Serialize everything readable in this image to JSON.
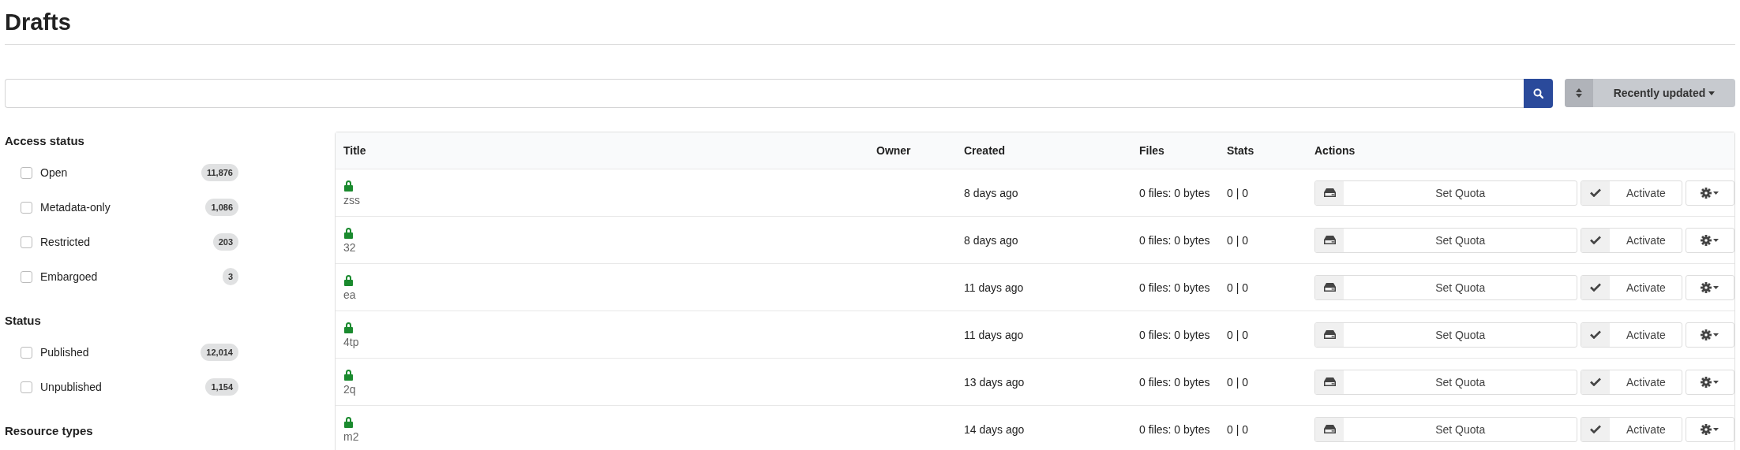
{
  "page": {
    "title": "Drafts"
  },
  "search": {
    "sort_label": "Recently updated"
  },
  "facets": [
    {
      "heading": "Access status",
      "items": [
        {
          "label": "Open",
          "count": "11,876",
          "checked": false
        },
        {
          "label": "Metadata-only",
          "count": "1,086",
          "checked": false
        },
        {
          "label": "Restricted",
          "count": "203",
          "checked": false
        },
        {
          "label": "Embargoed",
          "count": "3",
          "checked": false
        }
      ]
    },
    {
      "heading": "Status",
      "items": [
        {
          "label": "Published",
          "count": "12,014",
          "checked": false
        },
        {
          "label": "Unpublished",
          "count": "1,154",
          "checked": false
        }
      ]
    },
    {
      "heading": "Resource types"
    }
  ],
  "table": {
    "columns": [
      "Title",
      "Owner",
      "Created",
      "Files",
      "Stats",
      "Actions"
    ],
    "rows": [
      {
        "title": "zss",
        "created": "8 days ago",
        "files": "0 files: 0 bytes",
        "stats": "0 | 0",
        "quota": "Set Quota",
        "activate": "Activate"
      },
      {
        "title": "32",
        "created": "8 days ago",
        "files": "0 files: 0 bytes",
        "stats": "0 | 0",
        "quota": "Set Quota",
        "activate": "Activate"
      },
      {
        "title": "ea",
        "created": "11 days ago",
        "files": "0 files: 0 bytes",
        "stats": "0 | 0",
        "quota": "Set Quota",
        "activate": "Activate"
      },
      {
        "title": "4tp",
        "created": "11 days ago",
        "files": "0 files: 0 bytes",
        "stats": "0 | 0",
        "quota": "Set Quota",
        "activate": "Activate"
      },
      {
        "title": "2q",
        "created": "13 days ago",
        "files": "0 files: 0 bytes",
        "stats": "0 | 0",
        "quota": "Set Quota",
        "activate": "Activate"
      },
      {
        "title": "m2",
        "created": "14 days ago",
        "files": "0 files: 0 bytes",
        "stats": "0 | 0",
        "quota": "Set Quota",
        "activate": "Activate"
      }
    ]
  }
}
